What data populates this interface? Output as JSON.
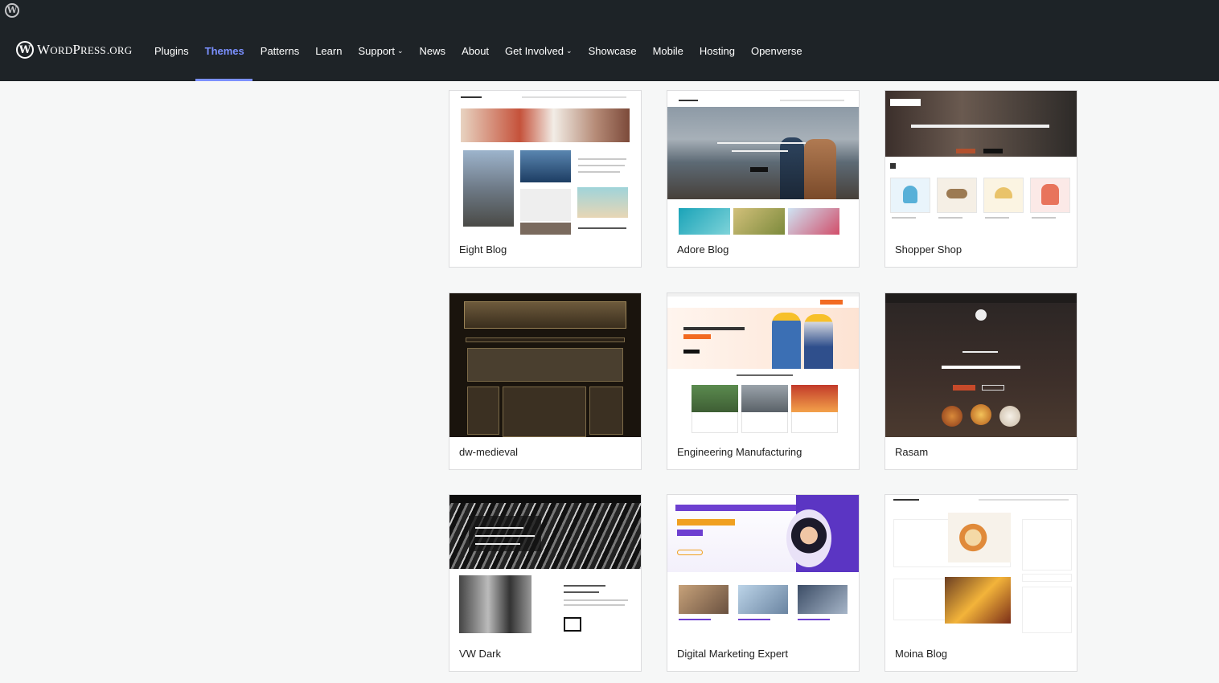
{
  "header": {
    "logo_word": "WordPress",
    "logo_org": ".ORG",
    "nav": [
      {
        "label": "Plugins"
      },
      {
        "label": "Themes",
        "active": true
      },
      {
        "label": "Patterns"
      },
      {
        "label": "Learn"
      },
      {
        "label": "Support",
        "dropdown": true
      },
      {
        "label": "News"
      },
      {
        "label": "About"
      },
      {
        "label": "Get Involved",
        "dropdown": true
      },
      {
        "label": "Showcase"
      },
      {
        "label": "Mobile"
      },
      {
        "label": "Hosting"
      },
      {
        "label": "Openverse"
      }
    ]
  },
  "themes": [
    {
      "name": "Eight Blog"
    },
    {
      "name": "Adore Blog"
    },
    {
      "name": "Shopper Shop"
    },
    {
      "name": "dw-medieval"
    },
    {
      "name": "Engineering Manufacturing"
    },
    {
      "name": "Rasam"
    },
    {
      "name": "VW Dark"
    },
    {
      "name": "Digital Marketing Expert"
    },
    {
      "name": "Moina Blog"
    }
  ],
  "colors": {
    "accent": "#7b90ff",
    "header_bg": "#1e2327",
    "adminbar_bg": "#1d2327"
  }
}
